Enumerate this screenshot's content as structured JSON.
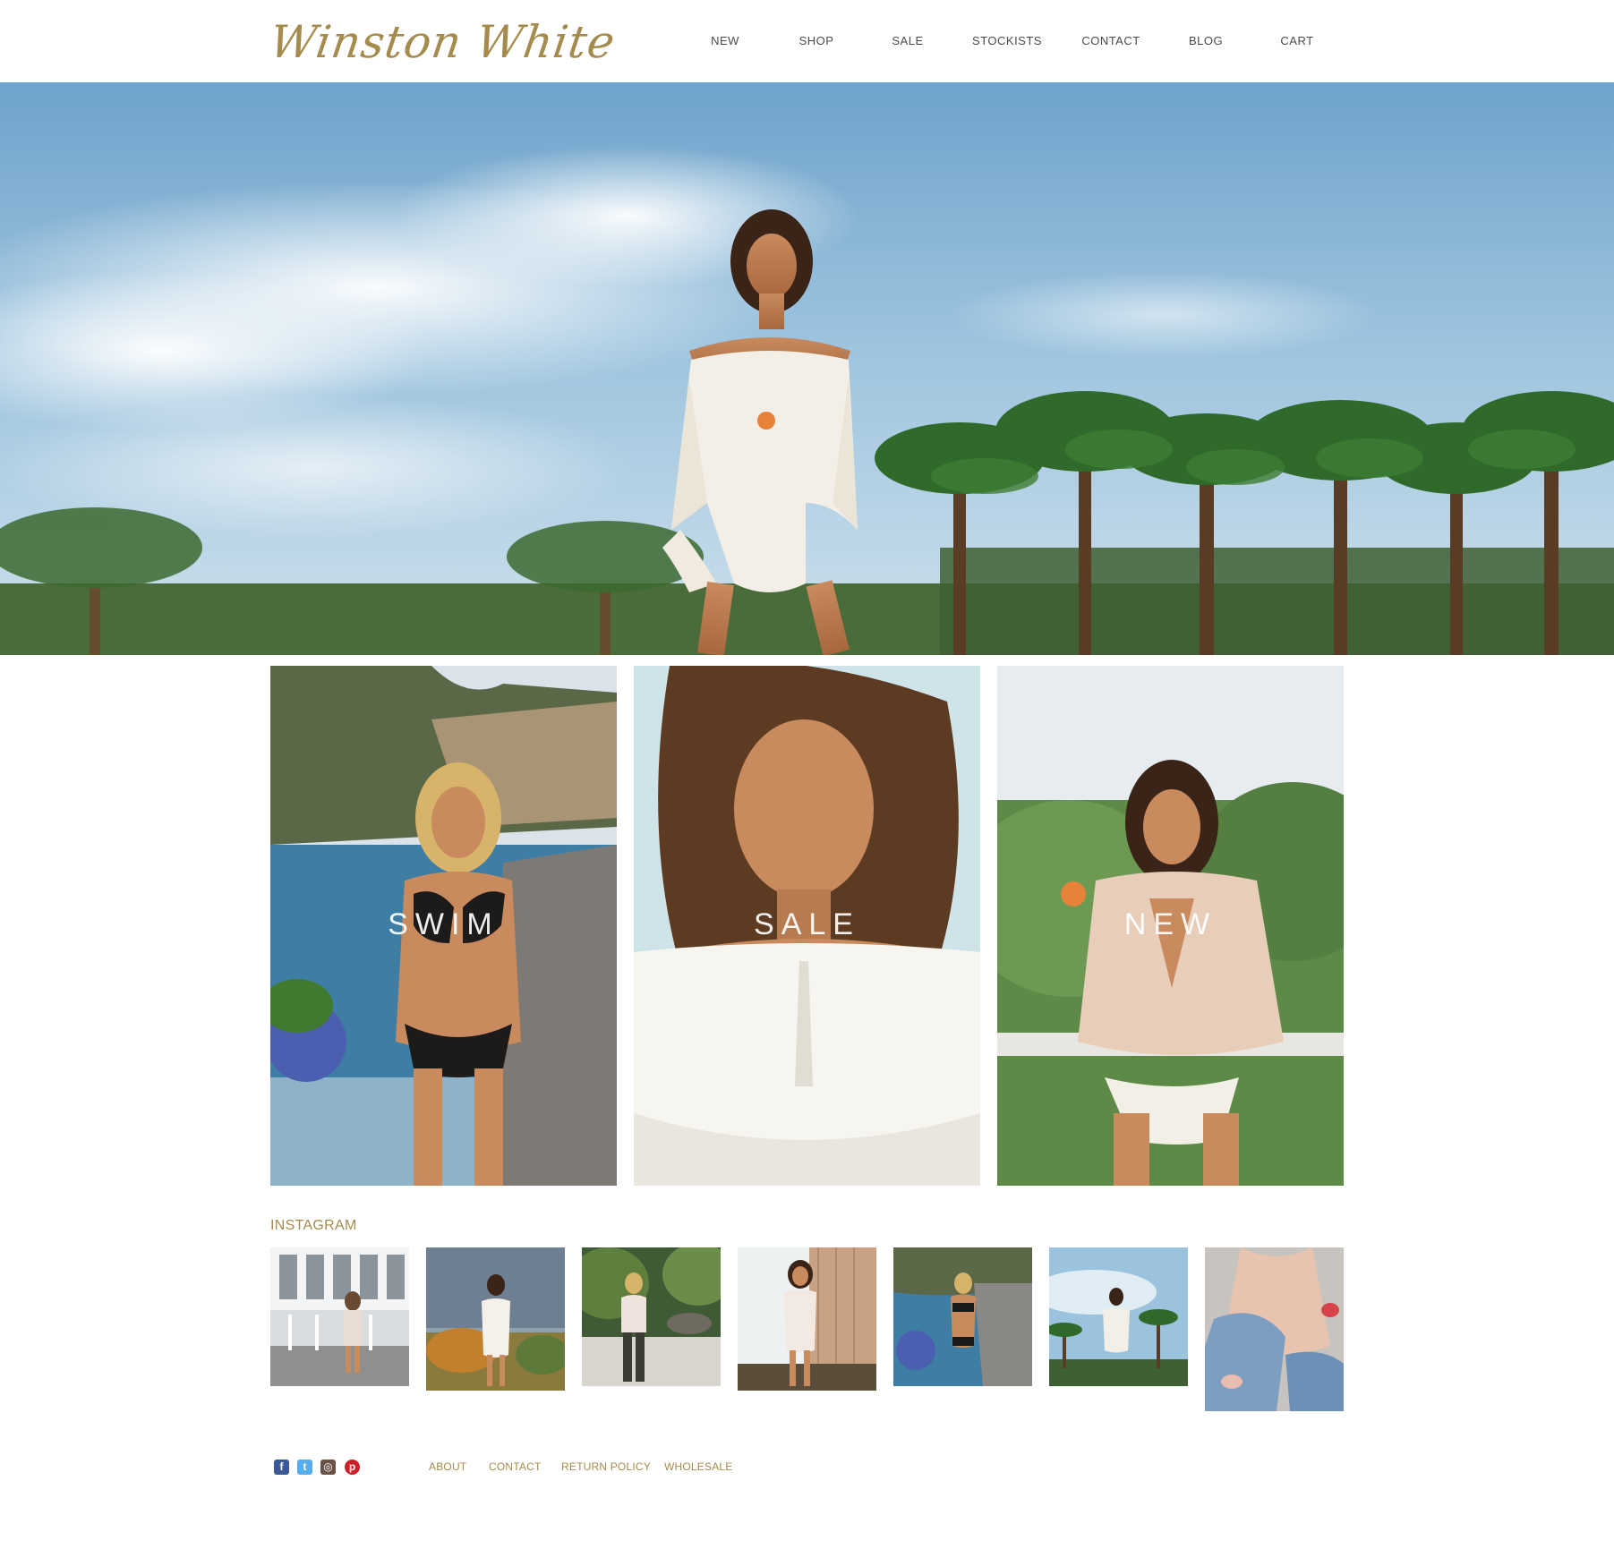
{
  "brand": {
    "logo_text": "Winston White",
    "accent_color": "#a58b4c"
  },
  "nav": {
    "items": [
      {
        "label": "NEW"
      },
      {
        "label": "SHOP"
      },
      {
        "label": "SALE"
      },
      {
        "label": "STOCKISTS"
      },
      {
        "label": "CONTACT"
      },
      {
        "label": "BLOG"
      },
      {
        "label": "CART"
      }
    ]
  },
  "categories": [
    {
      "label": "SWIM"
    },
    {
      "label": "SALE"
    },
    {
      "label": "NEW"
    }
  ],
  "instagram": {
    "heading": "INSTAGRAM",
    "posts": 7
  },
  "footer": {
    "social_icons": [
      "facebook-icon",
      "twitter-icon",
      "instagram-icon",
      "pinterest-icon"
    ],
    "links": [
      {
        "label": "ABOUT"
      },
      {
        "label": "CONTACT"
      },
      {
        "label": "RETURN POLICY"
      },
      {
        "label": "WHOLESALE"
      }
    ]
  }
}
